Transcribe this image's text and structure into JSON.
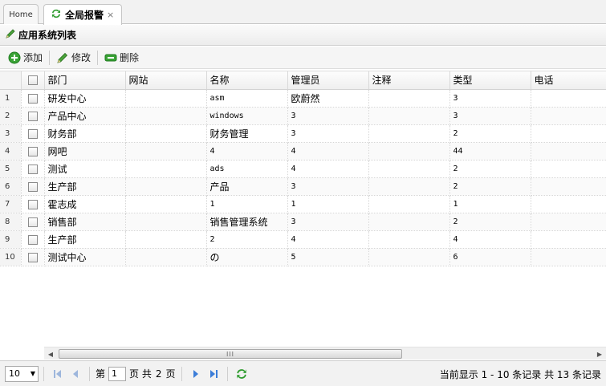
{
  "tabs": {
    "home": "Home",
    "active": "全局报警",
    "close": "×"
  },
  "panel": {
    "title": "应用系统列表"
  },
  "toolbar": {
    "add": "添加",
    "edit": "修改",
    "delete": "删除"
  },
  "columns": [
    "部门",
    "网站",
    "名称",
    "管理员",
    "注释",
    "类型",
    "电话"
  ],
  "rows": [
    {
      "n": "1",
      "dept": "研发中心",
      "site": "",
      "name": "asm",
      "admin": "欧蔚然",
      "note": "",
      "type": "3",
      "phone": ""
    },
    {
      "n": "2",
      "dept": "产品中心",
      "site": "",
      "name": "windows",
      "admin": "3",
      "note": "",
      "type": "3",
      "phone": ""
    },
    {
      "n": "3",
      "dept": "财务部",
      "site": "",
      "name": "财务管理",
      "admin": "3",
      "note": "",
      "type": "2",
      "phone": ""
    },
    {
      "n": "4",
      "dept": "网吧",
      "site": "",
      "name": "4",
      "admin": "4",
      "note": "",
      "type": "44",
      "phone": ""
    },
    {
      "n": "5",
      "dept": "测试",
      "site": "",
      "name": "ads",
      "admin": "4",
      "note": "",
      "type": "2",
      "phone": ""
    },
    {
      "n": "6",
      "dept": "生产部",
      "site": "",
      "name": "产品",
      "admin": "3",
      "note": "",
      "type": "2",
      "phone": ""
    },
    {
      "n": "7",
      "dept": "霍志成",
      "site": "",
      "name": "1",
      "admin": "1",
      "note": "",
      "type": "1",
      "phone": ""
    },
    {
      "n": "8",
      "dept": "销售部",
      "site": "",
      "name": "销售管理系统",
      "admin": "3",
      "note": "",
      "type": "2",
      "phone": ""
    },
    {
      "n": "9",
      "dept": "生产部",
      "site": "",
      "name": "2",
      "admin": "4",
      "note": "",
      "type": "4",
      "phone": ""
    },
    {
      "n": "10",
      "dept": "测试中心",
      "site": "",
      "name": "の",
      "admin": "5",
      "note": "",
      "type": "6",
      "phone": ""
    }
  ],
  "pager": {
    "page_size": "10",
    "label_page": "第",
    "current_page": "1",
    "label_of": "页 共",
    "total_pages": "2",
    "label_pages": "页",
    "info": "当前显示 1 - 10 条记录 共 13 条记录"
  },
  "scrollbar": {
    "grip": "III"
  },
  "colors": {
    "accent_green": "#2e9b2e",
    "nav_blue": "#3b7dd8"
  }
}
